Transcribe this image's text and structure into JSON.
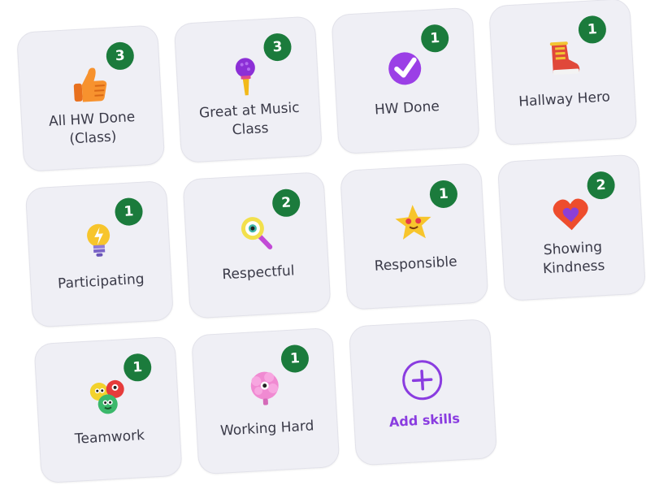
{
  "accent_color": "#8a3ce0",
  "badge_color": "#1b7b3c",
  "skills": [
    {
      "name": "All HW Done (Class)",
      "line1": "All HW Done",
      "line2": "(Class)",
      "count": "3",
      "icon": "thumbs-up-icon"
    },
    {
      "name": "Great at Music Class",
      "line1": "Great at Music",
      "line2": "Class",
      "count": "3",
      "icon": "microphone-icon"
    },
    {
      "name": "HW Done",
      "line1": "HW Done",
      "line2": "",
      "count": "1",
      "icon": "checkmark-icon"
    },
    {
      "name": "Hallway Hero",
      "line1": "Hallway Hero",
      "line2": "",
      "count": "1",
      "icon": "sneaker-icon"
    },
    {
      "name": "Participating",
      "line1": "Participating",
      "line2": "",
      "count": "1",
      "icon": "lightbulb-icon"
    },
    {
      "name": "Respectful",
      "line1": "Respectful",
      "line2": "",
      "count": "2",
      "icon": "magnifying-glass-icon"
    },
    {
      "name": "Responsible",
      "line1": "Responsible",
      "line2": "",
      "count": "1",
      "icon": "star-icon"
    },
    {
      "name": "Showing Kindness",
      "line1": "Showing",
      "line2": "Kindness",
      "count": "2",
      "icon": "heart-icon"
    },
    {
      "name": "Teamwork",
      "line1": "Teamwork",
      "line2": "",
      "count": "1",
      "icon": "monsters-icon"
    },
    {
      "name": "Working Hard",
      "line1": "Working Hard",
      "line2": "",
      "count": "1",
      "icon": "brain-icon"
    }
  ],
  "add_skills": {
    "label": "Add skills",
    "icon": "plus-icon"
  }
}
